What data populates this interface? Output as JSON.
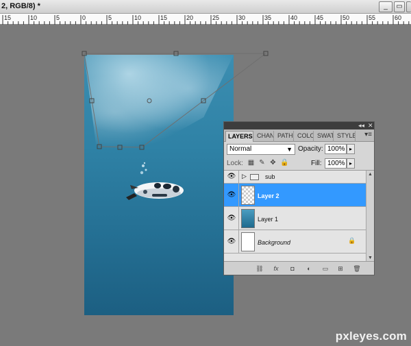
{
  "window": {
    "title": "2, RGB/8) *",
    "minimize_symbol": "_",
    "restore_symbol": "▭",
    "close_symbol": "✕"
  },
  "ruler": {
    "labels": [
      "15",
      "10",
      "5",
      "0",
      "5",
      "10",
      "15",
      "20",
      "25",
      "30",
      "35",
      "40",
      "45",
      "50",
      "55",
      "60"
    ]
  },
  "panel": {
    "collapse_symbol": "◂◂",
    "close_symbol": "✕",
    "tabs": [
      {
        "label": "LAYERS",
        "active": true
      },
      {
        "label": "CHAN",
        "active": false
      },
      {
        "label": "PATH",
        "active": false
      },
      {
        "label": "COLO",
        "active": false
      },
      {
        "label": "SWAT",
        "active": false
      },
      {
        "label": "STYLE",
        "active": false
      }
    ],
    "menu_symbol": "▾≡",
    "blend_mode": "Normal",
    "blend_arrow": "▼",
    "opacity_label": "Opacity:",
    "opacity_value": "100%",
    "spin_symbol": "▸",
    "lock_label": "Lock:",
    "fill_label": "Fill:",
    "fill_value": "100%",
    "lock_icons": [
      "▦",
      "✎",
      "✥",
      "🔒"
    ],
    "layers": [
      {
        "name": "sub",
        "kind": "group",
        "visible": true,
        "selected": false
      },
      {
        "name": "Layer 2",
        "kind": "transparent",
        "visible": true,
        "selected": true
      },
      {
        "name": "Layer 1",
        "kind": "gradient",
        "visible": true,
        "selected": false
      },
      {
        "name": "Background",
        "kind": "white",
        "visible": true,
        "selected": false,
        "locked": true
      }
    ],
    "eye_symbol": "👁",
    "group_arrow": "▷",
    "lock_badge": "🔒",
    "footer_icons": [
      "link-icon",
      "fx-icon",
      "mask-icon",
      "adjustment-icon",
      "folder-icon",
      "new-layer-icon",
      "trash-icon"
    ],
    "footer_glyphs": [
      "⛓",
      "fx",
      "◘",
      "◐",
      "▭",
      "⊞",
      "🗑"
    ]
  },
  "watermark": "pxleyes.com"
}
